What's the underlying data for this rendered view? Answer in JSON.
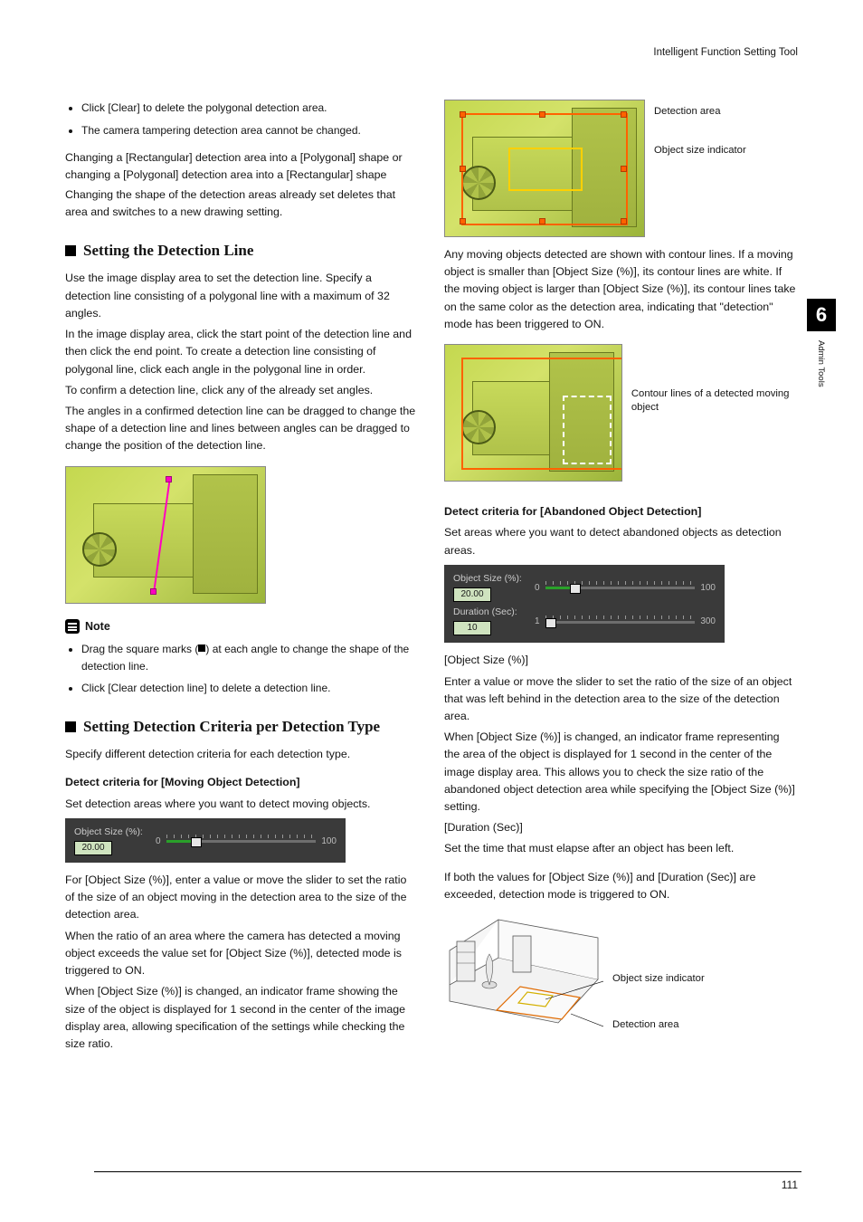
{
  "running_header": "Intelligent Function Setting Tool",
  "chapter": {
    "number": "6",
    "label": "Admin Tools"
  },
  "page_number": "111",
  "left": {
    "bullets_top": [
      "Click [Clear] to delete the polygonal detection area.",
      "The camera tampering detection area cannot be changed."
    ],
    "shape_change_heading": "Changing a [Rectangular] detection area into a [Polygonal] shape or changing a [Polygonal] detection area into a [Rectangular] shape",
    "shape_change_body": "Changing the shape of the detection areas already set deletes that area and switches to a new drawing setting.",
    "h_line": "Setting the Detection Line",
    "line_p1": "Use the image display area to set the detection line. Specify a detection line consisting of a polygonal line with a maximum of 32 angles.",
    "line_p2": "In the image display area, click the start point of the detection line and then click the end point. To create a detection line consisting of polygonal line, click each angle in the polygonal line in order.",
    "line_p3": "To confirm a detection line, click any of the already set angles.",
    "line_p4": "The angles in a confirmed detection line can be dragged to change the shape of a detection line and lines between angles can be dragged to change the position of the detection line.",
    "note_title": "Note",
    "note_bullets_pre": "Drag the square marks (",
    "note_bullets_post": ") at each angle to change the shape of the detection line.",
    "note_bullet2": "Click [Clear detection line] to delete a detection line.",
    "h_crit": "Setting Detection Criteria per Detection Type",
    "crit_intro": "Specify different detection criteria for each detection type.",
    "crit_moving_h": "Detect criteria for [Moving Object Detection]",
    "crit_moving_p": "Set detection areas where you want to detect moving objects.",
    "slider_obj_label": "Object Size (%):",
    "slider_obj_value": "20.00",
    "slider_min": "0",
    "slider_max": "100",
    "crit_moving_p2a": "For [Object Size (%)], enter a value or move the slider to set the ratio of the size of an object moving in the detection area to the size of the detection area.",
    "crit_moving_p2b": "When the ratio of an area where the camera has detected a moving object exceeds the value set for [Object Size (%)], detected mode is triggered to ON."
  },
  "right": {
    "intro": "When [Object Size (%)] is changed, an indicator frame showing the size of the object is displayed for 1 second in the center of the image display area, allowing specification of the settings while checking the size ratio.",
    "callout_det_area": "Detection area",
    "callout_size_ind": "Object size indicator",
    "contour_p": "Any moving objects detected are shown with contour lines. If a moving object is smaller than [Object Size (%)], its contour lines are white. If the moving object is larger than [Object Size (%)], its contour lines take on the same color as the detection area, indicating that \"detection\" mode has been triggered to ON.",
    "callout_contour": "Contour lines of a detected moving object",
    "crit_aband_h": "Detect criteria for [Abandoned Object Detection]",
    "crit_aband_p": "Set areas where you want to detect abandoned objects as detection areas.",
    "slider_obj_label": "Object Size (%):",
    "slider_obj_value": "20.00",
    "slider_obj_min": "0",
    "slider_obj_max": "100",
    "slider_dur_label": "Duration (Sec):",
    "slider_dur_value": "10",
    "slider_dur_min": "1",
    "slider_dur_max": "300",
    "obj_size_h": "[Object Size (%)]",
    "obj_size_p1": "Enter a value or move the slider to set the ratio of the size of an object that was left behind in the detection area to the size of the detection area.",
    "obj_size_p2": "When [Object Size (%)] is changed, an indicator frame representing the area of the object is displayed for 1 second in the center of the image display area. This allows you to check the size ratio of the abandoned object detection area while specifying the [Object Size (%)] setting.",
    "dur_h": "[Duration (Sec)]",
    "dur_p": "Set the time that must elapse after an object has been left.",
    "both_p": "If both the values for [Object Size (%)] and [Duration (Sec)] are exceeded, detection mode is triggered to ON.",
    "room_callout_size": "Object size indicator",
    "room_callout_area": "Detection area"
  }
}
